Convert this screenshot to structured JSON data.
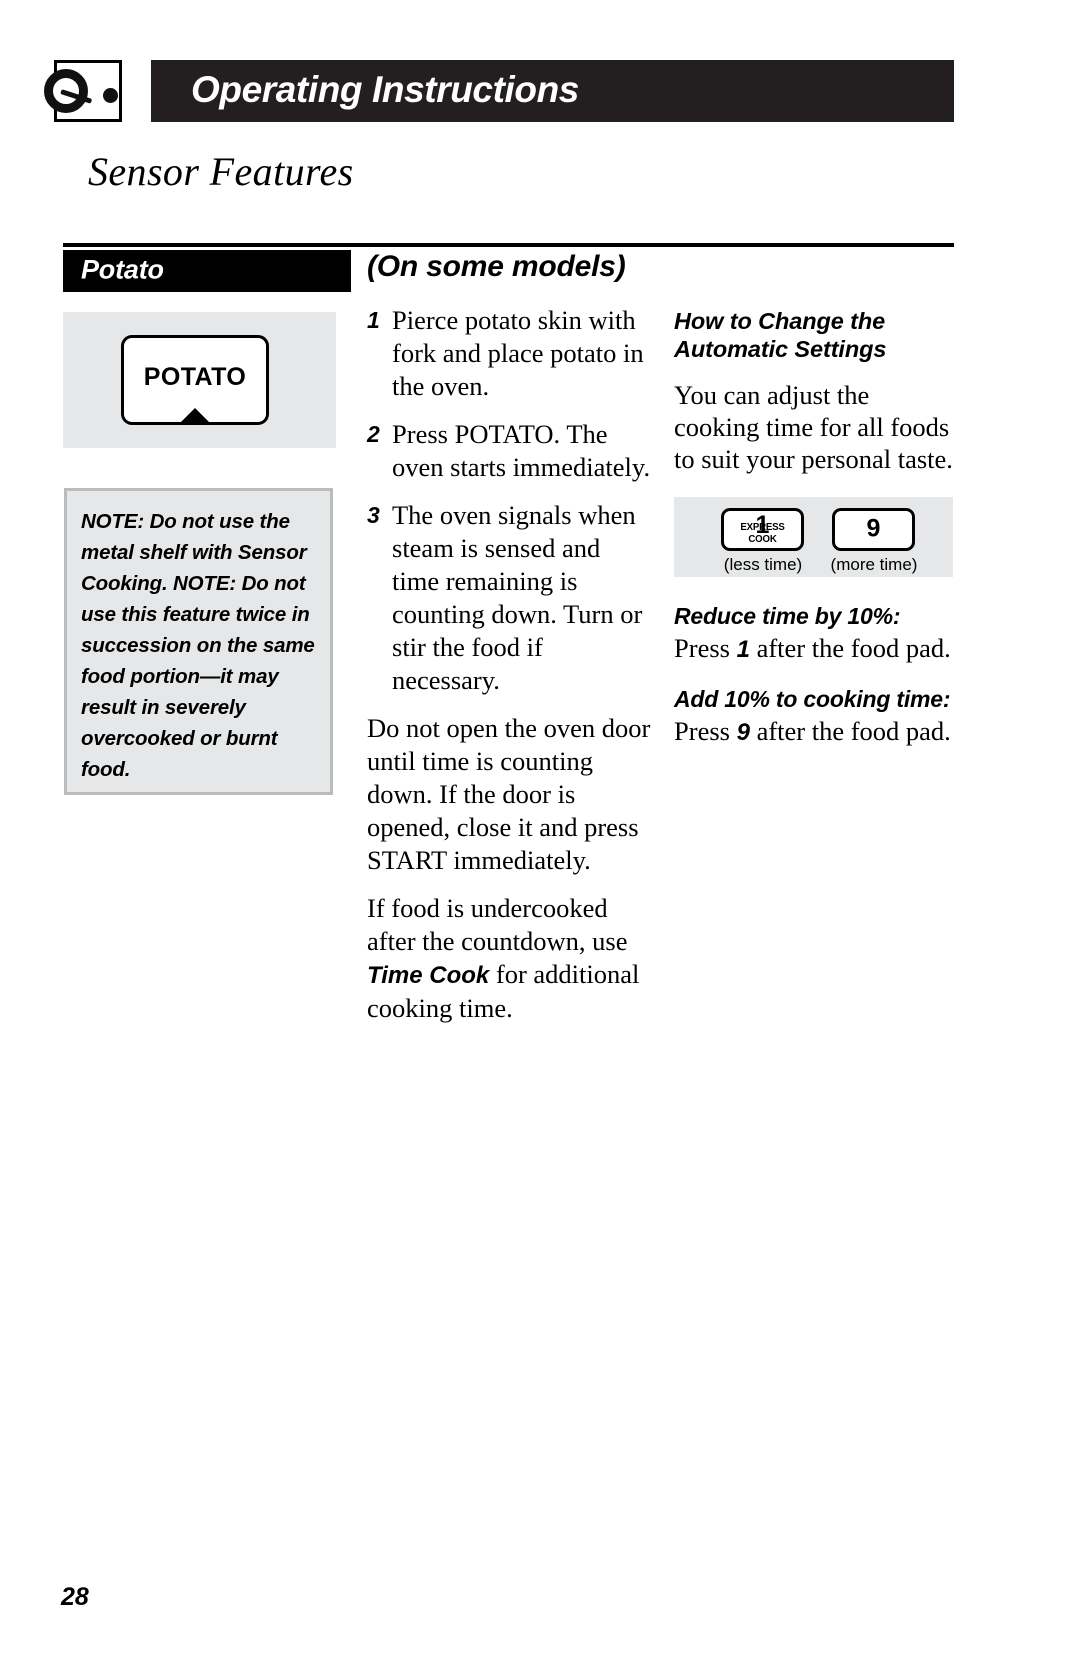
{
  "header": {
    "title": "Operating Instructions",
    "icon": "microwave-dial-icon"
  },
  "section": {
    "title": "Sensor Features"
  },
  "left_column": {
    "banner_label": "Potato",
    "key_label": "POTATO",
    "note_text": "NOTE: Do not use the metal shelf with Sensor Cooking. NOTE: Do not use this feature twice in succession on the same food portion—it may result in severely overcooked or burnt food."
  },
  "middle_column": {
    "models_heading": "(On some models)",
    "steps": [
      {
        "num": "1",
        "text": "Pierce potato skin with fork and place potato in the oven."
      },
      {
        "num": "2",
        "text": "Press POTATO. The oven starts immediately."
      },
      {
        "num": "3",
        "text": "The oven signals when steam is sensed and time remaining is counting down. Turn or stir the food if necessary."
      }
    ],
    "paragraph_1": "Do not open the oven door until time is counting down. If the door is opened, close it and press START immediately.",
    "paragraph_2_part1": "If food is undercooked after the countdown, use ",
    "paragraph_2_emphasis": "Time Cook",
    "paragraph_2_part2": " for additional cooking time."
  },
  "right_column": {
    "heading": "How to Change the Automatic Settings",
    "intro": "You can adjust the cooking time for all foods to suit your personal taste.",
    "keypad": {
      "key_less": {
        "digit": "1",
        "sublabel": "EXPRESS COOK"
      },
      "key_more": {
        "digit": "9"
      },
      "label_less": "(less time)",
      "label_more": "(more time)"
    },
    "reduce_heading": "Reduce time by 10%:",
    "reduce_body_part1": "Press ",
    "reduce_body_num": "1",
    "reduce_body_part2": " after the food pad.",
    "add_heading": "Add 10% to cooking time:",
    "add_body_part1": "Press ",
    "add_body_num": "9",
    "add_body_part2": " after the food pad."
  },
  "footer": {
    "page_number": "28"
  },
  "colors": {
    "header_bar": "#231f20",
    "panel_gray": "#e6e7e8",
    "note_border": "#b9bbbd"
  }
}
